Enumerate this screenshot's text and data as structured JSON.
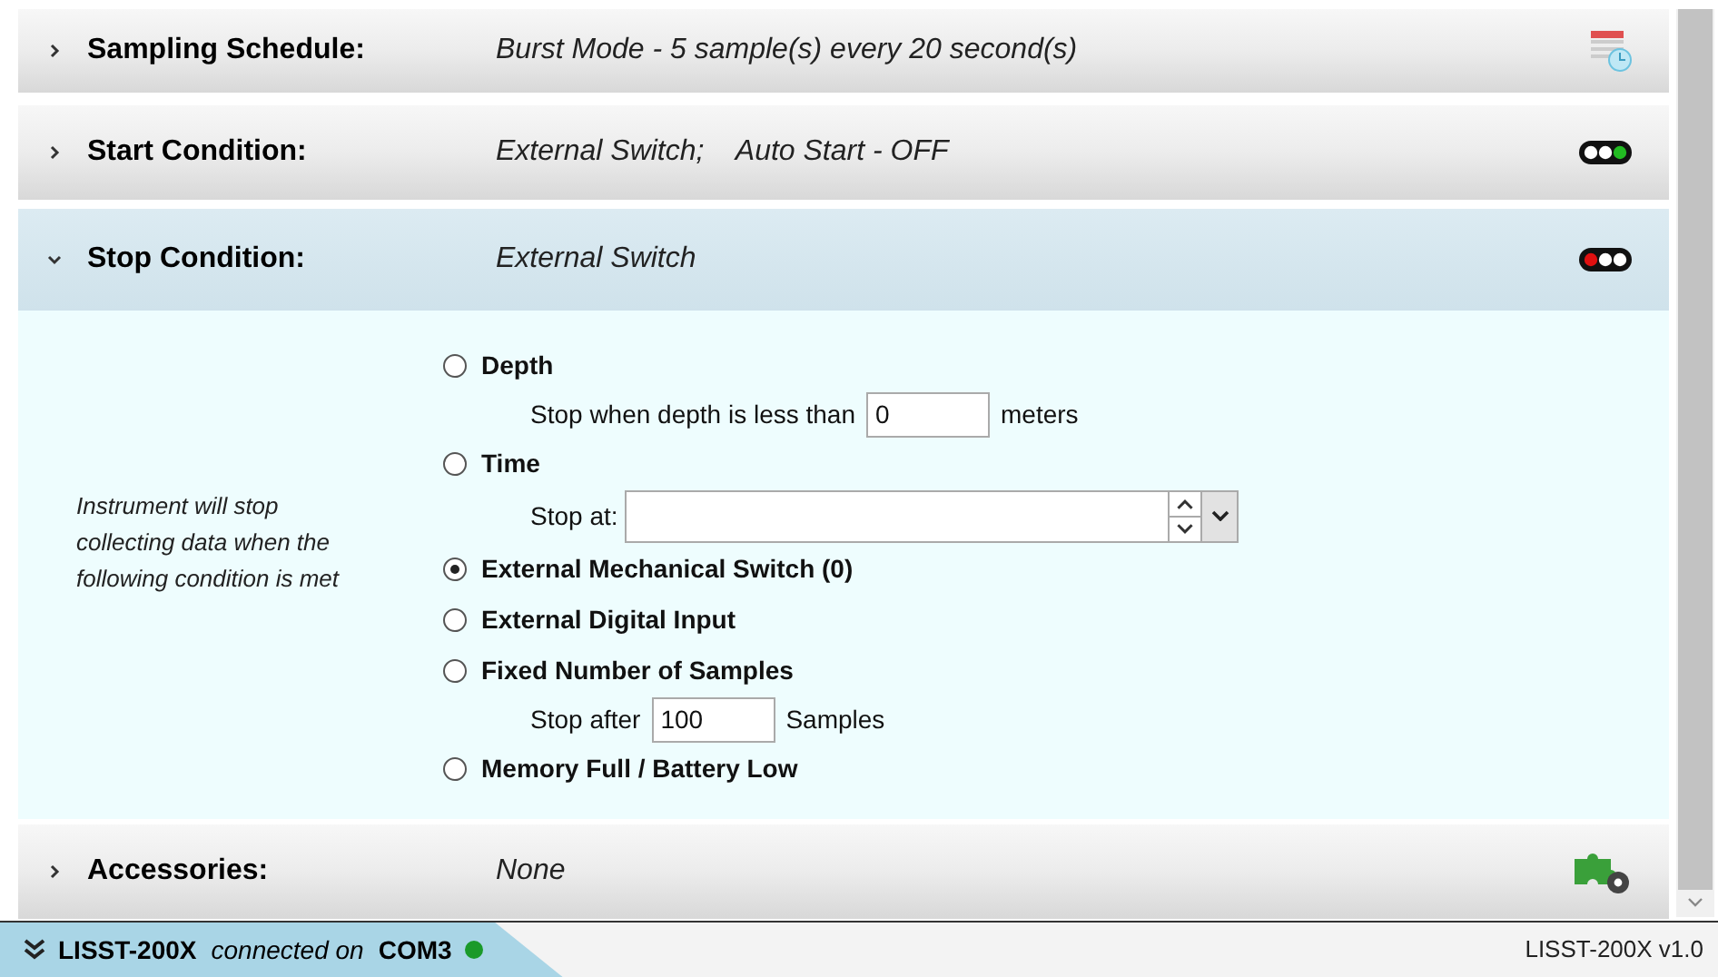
{
  "sections": [
    {
      "title": "Sampling Schedule:",
      "summary": "Burst Mode - 5 sample(s) every 20 second(s)",
      "expanded": false,
      "kind": "schedule"
    },
    {
      "title": "Start Condition:",
      "summary": "External Switch;    Auto Start - OFF",
      "expanded": false,
      "kind": "light",
      "lamps": [
        {
          "color": "#ffffff"
        },
        {
          "color": "#ffffff"
        },
        {
          "color": "#22bb22"
        }
      ]
    },
    {
      "title": "Stop Condition:",
      "summary": "External Switch",
      "expanded": true,
      "kind": "light",
      "lamps": [
        {
          "color": "#e01010"
        },
        {
          "color": "#ffffff"
        },
        {
          "color": "#ffffff"
        }
      ]
    },
    {
      "title": "Accessories:",
      "summary": "None",
      "expanded": false,
      "kind": "accessory"
    }
  ],
  "stop_panel": {
    "description": "Instrument will stop collecting data when the following condition is met",
    "items": [
      {
        "kind": "radio",
        "label": "Depth",
        "selected": false
      },
      {
        "kind": "number",
        "prefix": "Stop when depth is less than",
        "value": "0",
        "suffix": "meters"
      },
      {
        "kind": "radio",
        "label": "Time",
        "selected": false
      },
      {
        "kind": "datetime",
        "prefix": "Stop at:"
      },
      {
        "kind": "radio",
        "label": "External Mechanical Switch (0)",
        "selected": true
      },
      {
        "kind": "radio",
        "label": "External Digital Input",
        "selected": false
      },
      {
        "kind": "radio",
        "label": "Fixed Number of Samples",
        "selected": false
      },
      {
        "kind": "number",
        "prefix": "Stop after",
        "value": "100",
        "suffix": "Samples"
      },
      {
        "kind": "radio",
        "label": "Memory Full / Battery Low",
        "selected": false
      }
    ]
  },
  "status_bar": {
    "device": "LISST-200X",
    "connected_text": "connected on",
    "port": "COM3",
    "connected": true,
    "version": "LISST-200X v1.0"
  }
}
